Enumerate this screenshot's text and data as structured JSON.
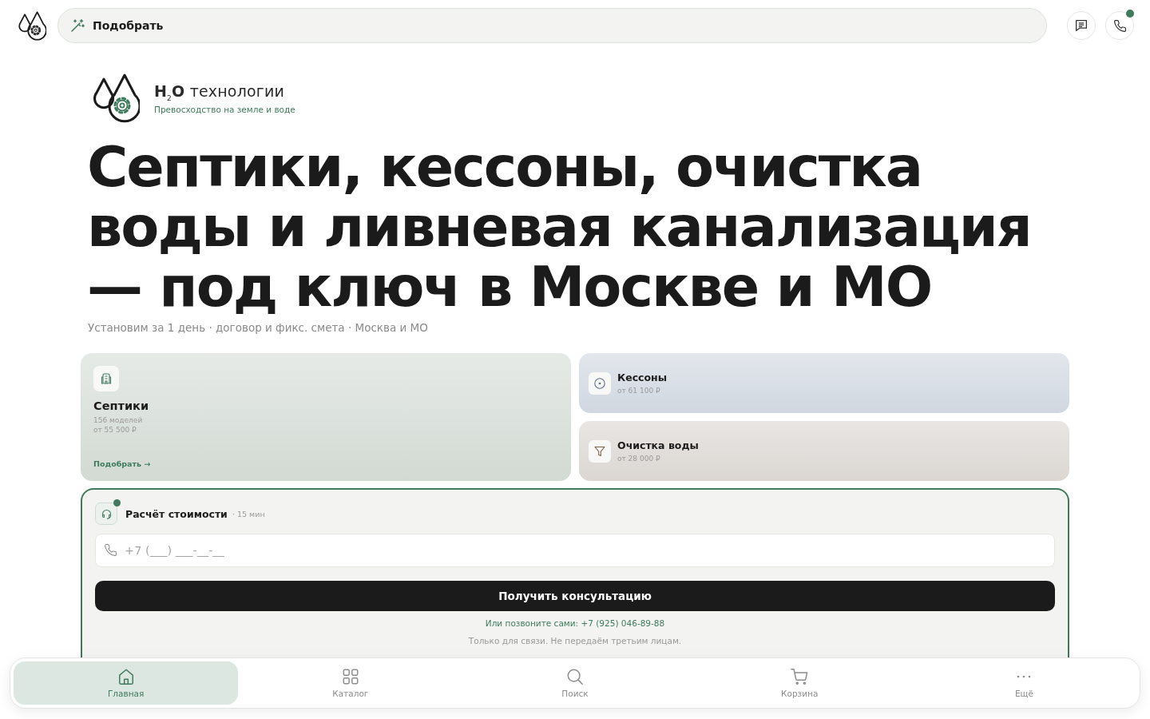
{
  "topbar": {
    "search": {
      "label": "Подобрать"
    },
    "actions": [
      {
        "kind": "chat",
        "dot": false
      },
      {
        "kind": "phone",
        "dot": true
      }
    ]
  },
  "brand": {
    "name": "**H**$_{2}$**O** технологии",
    "tagline": "Превосходство на земле и воде"
  },
  "hero": {
    "title": "Септики, кессоны, очистка воды и ливневая канализация — под ключ в Москве и МО",
    "subtitle": "Установим за 1 день · договор и фикс. смета · Москва и МО"
  },
  "categories": [
    {
      "kind": "septic",
      "featured": true,
      "title": "Септики",
      "count": "156 моделей",
      "price": "от 55 500 ₽",
      "link": "Подобрать →"
    },
    {
      "kind": "caisson",
      "featured": false,
      "title": "Кессоны",
      "price": "от 61 100 ₽"
    },
    {
      "kind": "filter",
      "featured": false,
      "title": "Очистка воды",
      "price": "от 28 000 ₽"
    }
  ],
  "quote_form": {
    "title": "Расчёт стоимости",
    "duration": "· 15 мин",
    "online": true,
    "phone_field": {
      "placeholder": "+7 (___) ___-__-__"
    },
    "submit": "Получить консультацию",
    "call_label": "Или позвоните сами:",
    "call_phone": "+7 (925) 046-89-88",
    "privacy": "Только для связи. Не передаём третьим лицам."
  },
  "bottom_nav": [
    {
      "kind": "home",
      "label": "Главная",
      "selected": true
    },
    {
      "kind": "catalog",
      "label": "Каталог",
      "selected": false
    },
    {
      "kind": "search",
      "label": "Поиск",
      "selected": false
    },
    {
      "kind": "cart",
      "label": "Корзина",
      "selected": false
    },
    {
      "kind": "more",
      "label": "Ещё",
      "selected": false
    }
  ]
}
